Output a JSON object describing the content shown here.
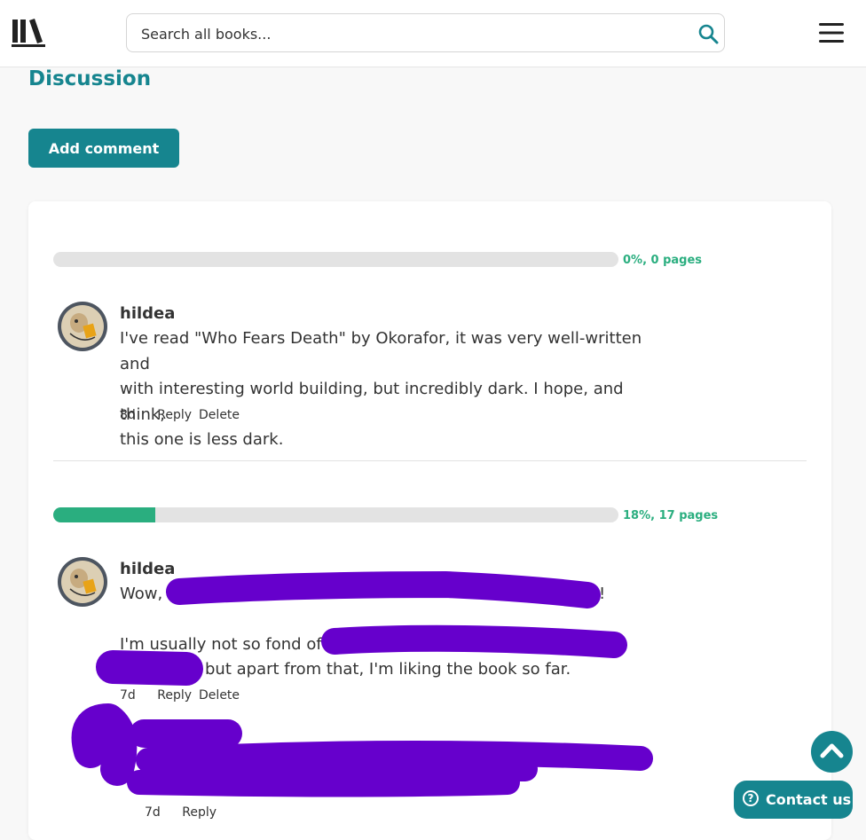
{
  "header": {
    "search_placeholder": "Search all books...",
    "icons": [
      "library-logo-icon",
      "search-icon",
      "hamburger-menu-icon"
    ]
  },
  "page": {
    "title": "Discussion",
    "add_comment_label": "Add comment"
  },
  "comments": [
    {
      "progress_percent": 0,
      "progress_label": "0%, 0 pages",
      "user": "hildea",
      "lines": [
        "I've read \"Who Fears Death\" by Okorafor, it was very well-written and",
        "with interesting world building, but incredibly dark. I hope, and think,",
        "this one is less dark."
      ],
      "age": "8d",
      "reply": "Reply",
      "delete": "Delete"
    },
    {
      "progress_percent": 18,
      "progress_label": "18%, 17 pages",
      "user": "hildea",
      "line1_start": "Wow,",
      "line1_end": "!",
      "line2_start": "I'm usually not so fond of",
      "line3_end": "but apart from that, I'm liking the book so far.",
      "age": "7d",
      "reply": "Reply",
      "delete": "Delete"
    }
  ],
  "reply_comment": {
    "age": "7d",
    "reply": "Reply"
  },
  "floating": {
    "contact_label": "Contact us"
  },
  "colors": {
    "accent": "#16858f",
    "progress": "#2aae7f",
    "redaction": "#6600cc"
  }
}
